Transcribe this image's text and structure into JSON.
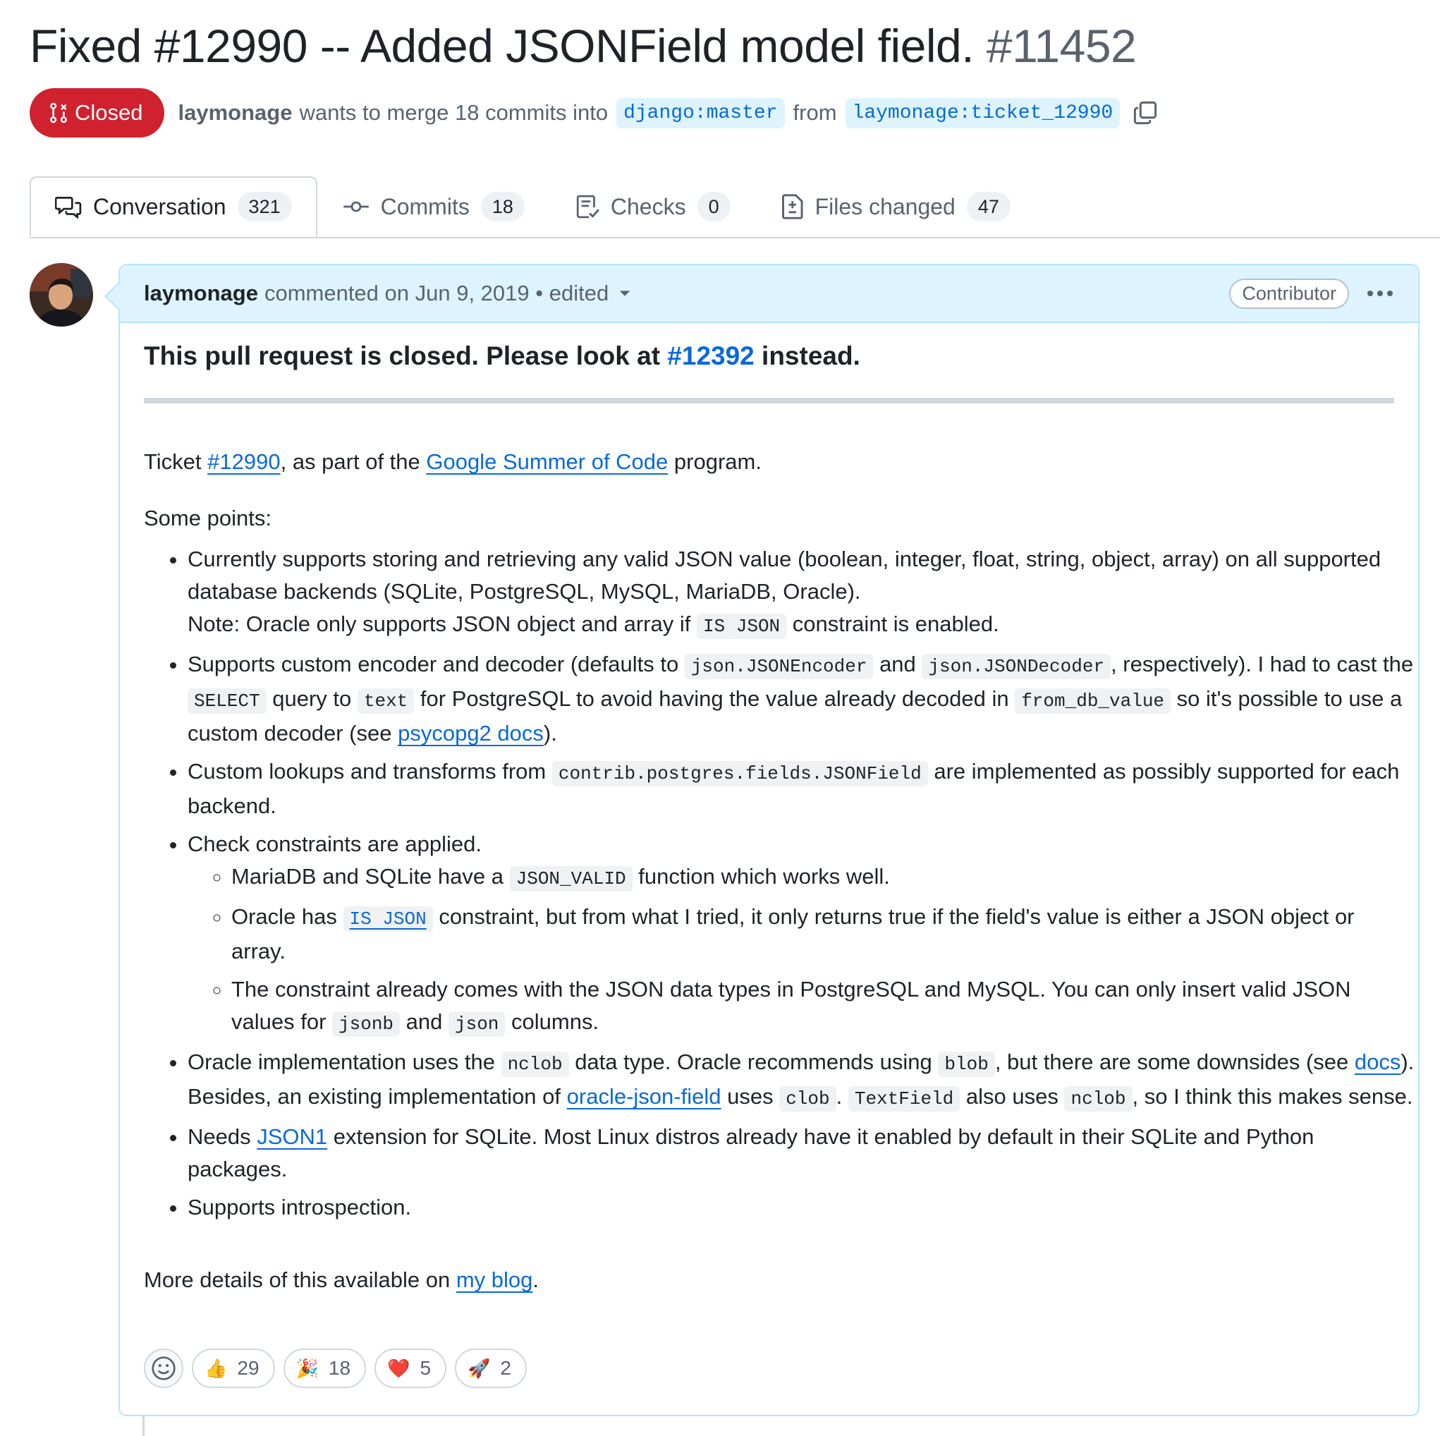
{
  "header": {
    "title": "Fixed #12990 -- Added JSONField model field.",
    "number": "#11452",
    "state": "Closed",
    "author": "laymonage",
    "merge_text": "wants to merge 18 commits into",
    "base_branch": "django:master",
    "from_text": "from",
    "head_branch": "laymonage:ticket_12990"
  },
  "tabs": [
    {
      "label": "Conversation",
      "count": "321",
      "icon": "comment-discussion-icon"
    },
    {
      "label": "Commits",
      "count": "18",
      "icon": "git-commit-icon"
    },
    {
      "label": "Checks",
      "count": "0",
      "icon": "checklist-icon"
    },
    {
      "label": "Files changed",
      "count": "47",
      "icon": "file-diff-icon"
    }
  ],
  "comment": {
    "author": "laymonage",
    "meta": "commented on Jun 9, 2019 •",
    "edited": "edited",
    "role": "Contributor",
    "notice_pre": "This pull request is closed. Please look at ",
    "notice_link": "#12392",
    "notice_post": " instead.",
    "ticket": {
      "t1": "Ticket ",
      "link1": "#12990",
      "t2": ", as part of the ",
      "link2": "Google Summer of Code",
      "t3": " program."
    },
    "some_points": "Some points:",
    "points": {
      "p1": {
        "a": "Currently supports storing and retrieving any valid JSON value (boolean, integer, float, string, object, array) on all supported database backends (SQLite, PostgreSQL, MySQL, MariaDB, Oracle).",
        "b": "Note: Oracle only supports JSON object and array if ",
        "code": "IS JSON",
        "c": " constraint is enabled."
      },
      "p2": {
        "a": "Supports custom encoder and decoder (defaults to ",
        "code1": "json.JSONEncoder",
        "b": " and ",
        "code2": "json.JSONDecoder",
        "c": ", respectively). I had to cast the ",
        "code3": "SELECT",
        "d": " query to ",
        "code4": "text",
        "e": " for PostgreSQL to avoid having the value already decoded in ",
        "code5": "from_db_value",
        "f": " so it's possible to use a custom decoder (see ",
        "link": "psycopg2 docs",
        "g": ")."
      },
      "p3": {
        "a": "Custom lookups and transforms from ",
        "code": "contrib.postgres.fields.JSONField",
        "b": " are implemented as possibly supported for each backend."
      },
      "p4": {
        "a": "Check constraints are applied.",
        "s1a": "MariaDB and SQLite have a ",
        "s1code": "JSON_VALID",
        "s1b": " function which works well.",
        "s2a": "Oracle has ",
        "s2code": "IS JSON",
        "s2b": " constraint, but from what I tried, it only returns true if the field's value is either a JSON object or array.",
        "s3a": "The constraint already comes with the JSON data types in PostgreSQL and MySQL. You can only insert valid JSON values for ",
        "s3code1": "jsonb",
        "s3b": " and ",
        "s3code2": "json",
        "s3c": " columns."
      },
      "p5": {
        "a": "Oracle implementation uses the ",
        "code1": "nclob",
        "b": " data type. Oracle recommends using ",
        "code2": "blob",
        "c": ", but there are some downsides (see ",
        "link1": "docs",
        "d": "). Besides, an existing implementation of ",
        "link2": "oracle-json-field",
        "e": " uses ",
        "code3": "clob",
        "f": ". ",
        "code4": "TextField",
        "g": " also uses ",
        "code5": "nclob",
        "h": ", so I think this makes sense."
      },
      "p6": {
        "a": "Needs ",
        "link": "JSON1",
        "b": " extension for SQLite. Most Linux distros already have it enabled by default in their SQLite and Python packages."
      },
      "p7": "Supports introspection."
    },
    "more": {
      "a": "More details of this available on ",
      "link": "my blog",
      "b": "."
    }
  },
  "reactions": [
    {
      "emoji": "👍",
      "name": "thumbs-up",
      "count": "29"
    },
    {
      "emoji": "🎉",
      "name": "hooray",
      "count": "18"
    },
    {
      "emoji": "❤️",
      "name": "heart",
      "count": "5"
    },
    {
      "emoji": "🚀",
      "name": "rocket",
      "count": "2"
    }
  ],
  "colors": {
    "closed": "#cf222e",
    "link": "#0969da",
    "header_bg": "#ddf4ff"
  }
}
